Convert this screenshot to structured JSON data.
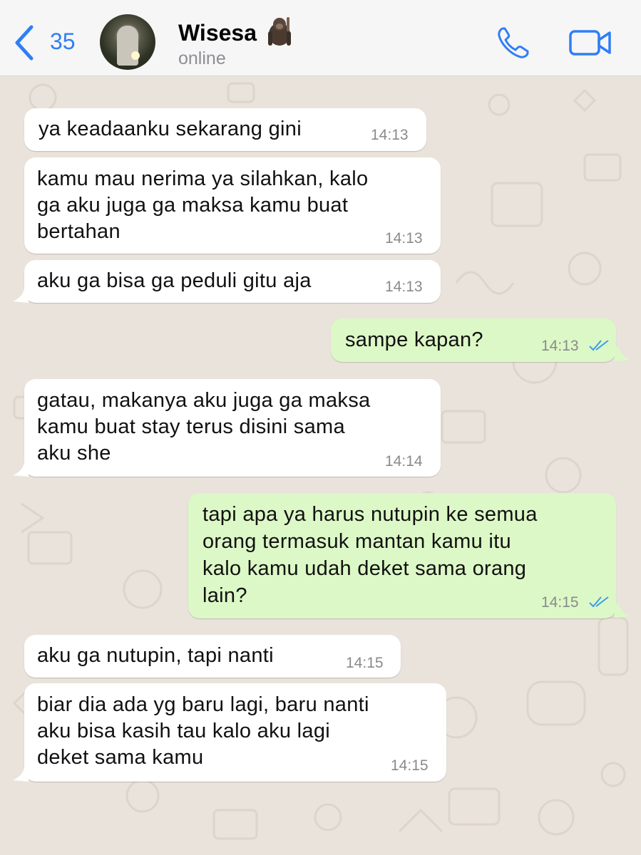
{
  "header": {
    "back_count": "35",
    "contact_name": "Wisesa",
    "contact_emoji": "gorilla-emoji",
    "status": "online",
    "call_icon": "phone-icon",
    "video_icon": "video-camera-icon",
    "accent_color": "#2f7ef6"
  },
  "colors": {
    "incoming_bubble": "#ffffff",
    "outgoing_bubble": "#dcf8c6",
    "wallpaper": "#e9e3db",
    "read_ticks": "#3d9de6"
  },
  "messages": [
    {
      "direction": "incoming",
      "lines": [
        "ya keadaanku sekarang gini"
      ],
      "time": "14:13"
    },
    {
      "direction": "incoming",
      "lines": [
        "kamu mau nerima ya silahkan, kalo",
        "ga aku juga ga maksa kamu buat",
        "bertahan"
      ],
      "time": "14:13"
    },
    {
      "direction": "incoming",
      "lines": [
        "aku ga bisa ga peduli gitu aja"
      ],
      "time": "14:13"
    },
    {
      "direction": "outgoing",
      "lines": [
        "sampe kapan?"
      ],
      "time": "14:13",
      "status": "read"
    },
    {
      "direction": "incoming",
      "lines": [
        "gatau, makanya aku juga ga maksa",
        "kamu buat stay terus disini sama",
        "aku she"
      ],
      "time": "14:14"
    },
    {
      "direction": "outgoing",
      "lines": [
        "tapi apa ya harus nutupin ke semua",
        "orang termasuk mantan kamu itu",
        "kalo kamu udah deket sama orang",
        "lain?"
      ],
      "time": "14:15",
      "status": "read"
    },
    {
      "direction": "incoming",
      "lines": [
        "aku ga nutupin, tapi nanti"
      ],
      "time": "14:15"
    },
    {
      "direction": "incoming",
      "lines": [
        "biar dia ada yg baru lagi, baru nanti",
        "aku bisa kasih tau kalo aku lagi",
        "deket sama kamu"
      ],
      "time": "14:15"
    }
  ]
}
